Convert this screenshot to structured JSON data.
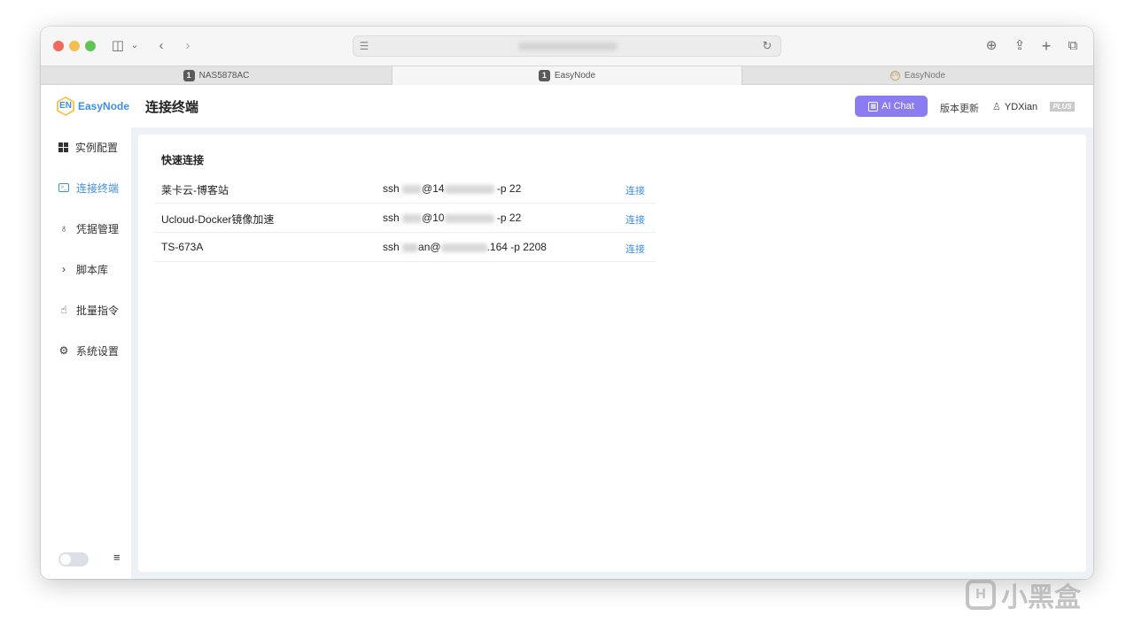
{
  "browser": {
    "tabs": [
      {
        "badge": "1",
        "label": "NAS5878AC",
        "active": false
      },
      {
        "badge": "1",
        "label": "EasyNode",
        "active": true
      },
      {
        "badge": "EN",
        "label": "EasyNode",
        "active": false
      }
    ]
  },
  "app": {
    "logo_mark": "EN",
    "logo_text": "EasyNode",
    "page_title": "连接终端",
    "ai_chat_label": "AI Chat",
    "update_label": "版本更新",
    "username": "YDXian",
    "plus_badge": "PLUS"
  },
  "sidebar": {
    "items": [
      {
        "label": "实例配置",
        "icon": "grid-icon"
      },
      {
        "label": "连接终端",
        "icon": "terminal-icon",
        "active": true
      },
      {
        "label": "凭据管理",
        "icon": "key-icon"
      },
      {
        "label": "脚本库",
        "icon": "chevron-right-icon"
      },
      {
        "label": "批量指令",
        "icon": "pointer-icon"
      },
      {
        "label": "系统设置",
        "icon": "gear-icon"
      }
    ]
  },
  "quick_connect": {
    "title": "快速连接",
    "connect_label": "连接",
    "rows": [
      {
        "name": "莱卡云-博客站",
        "cmd_prefix": "ssh",
        "cmd_mid": "@14",
        "cmd_suffix": "-p 22"
      },
      {
        "name": "Ucloud-Docker镜像加速",
        "cmd_prefix": "ssh",
        "cmd_mid": "@10",
        "cmd_suffix": "-p 22"
      },
      {
        "name": "TS-673A",
        "cmd_prefix": "ssh",
        "cmd_mid": "an@",
        "cmd_suffix": ".164 -p 2208"
      }
    ]
  },
  "watermark": {
    "text": "小黑盒"
  }
}
